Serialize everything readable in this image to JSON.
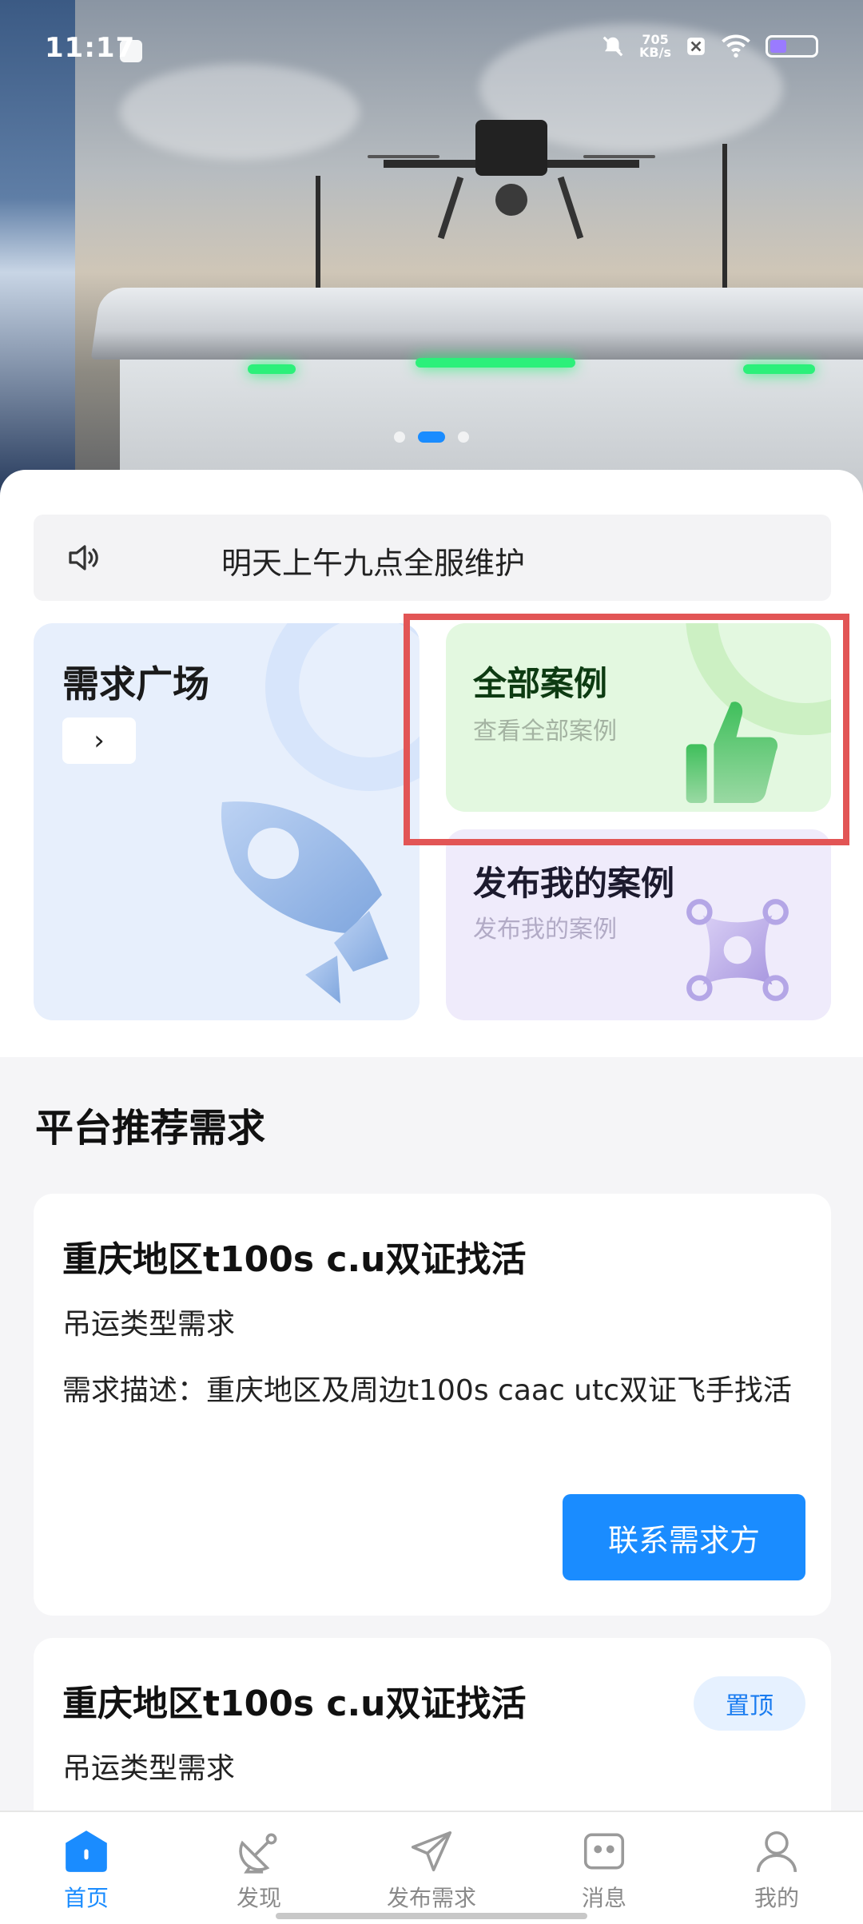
{
  "status_bar": {
    "time": "11:17",
    "net_speed_value": "705",
    "net_speed_unit": "KB/s",
    "battery_level": 0.34
  },
  "banner": {
    "active_slide": 2,
    "slide_count": 3
  },
  "notice": {
    "text": "明天上午九点全服维护"
  },
  "tiles": {
    "demand_square": {
      "title": "需求广场",
      "arrow": "›"
    },
    "all_cases": {
      "title": "全部案例",
      "subtitle": "查看全部案例"
    },
    "publish_case": {
      "title": "发布我的案例",
      "subtitle": "发布我的案例"
    }
  },
  "section": {
    "title": "平台推荐需求"
  },
  "requests": [
    {
      "title": "重庆地区t100s c.u双证找活",
      "type": "吊运类型需求",
      "description": "需求描述：重庆地区及周边t100s caac utc双证飞手找活",
      "action": "联系需求方"
    },
    {
      "title": "重庆地区t100s c.u双证找活",
      "type": "吊运类型需求",
      "badge": "置顶"
    }
  ],
  "bottom_nav": [
    {
      "label": "首页",
      "icon": "home-icon",
      "active": true
    },
    {
      "label": "发现",
      "icon": "satellite-dish-icon",
      "active": false
    },
    {
      "label": "发布需求",
      "icon": "send-icon",
      "active": false
    },
    {
      "label": "消息",
      "icon": "message-icon",
      "active": false
    },
    {
      "label": "我的",
      "icon": "user-icon",
      "active": false
    }
  ],
  "colors": {
    "accent": "#1a8cff",
    "highlight_border": "#e25555",
    "cases_tile": "#e3f8e0",
    "demand_tile": "#e7effc",
    "publish_tile": "#efebfb"
  }
}
